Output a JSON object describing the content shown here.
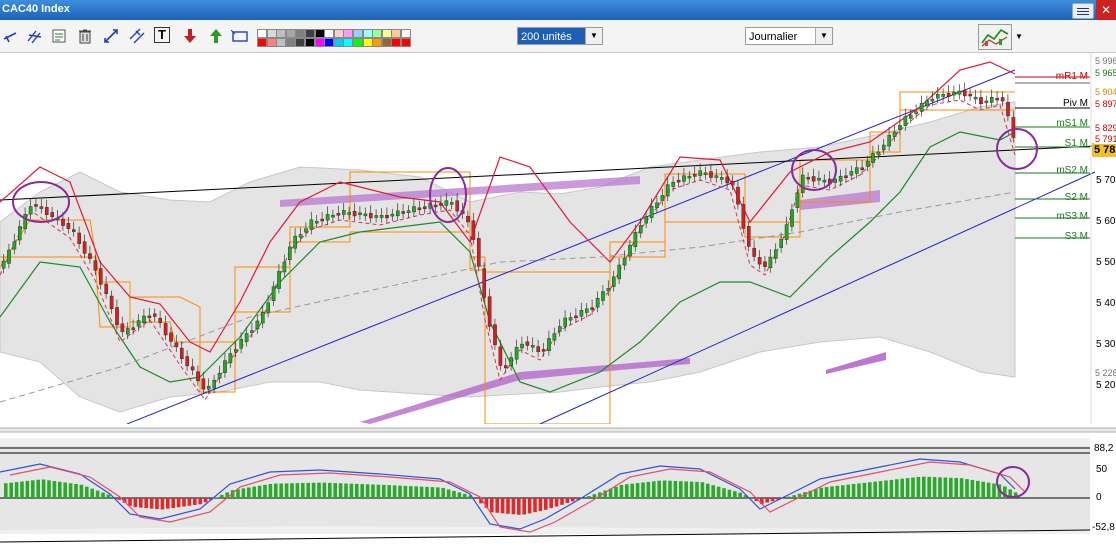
{
  "window": {
    "title": "CAC40 Index",
    "close_symbol": "✕"
  },
  "toolbar": {
    "tools": [
      "cursor-icon",
      "multi-line-icon",
      "draw-line-icon",
      "report-icon",
      "trash-icon",
      "scale-arrows-icon",
      "parallel-lines-icon",
      "text-tool-icon",
      "buy-arrow-icon",
      "sell-arrow-icon",
      "rectangle-tool-icon"
    ],
    "text_tool_glyph": "T",
    "units_select": "200 unités",
    "period_select": "Journalier",
    "palette": [
      "#ffffff",
      "#d9d9d9",
      "#bfbfbf",
      "#a6a6a6",
      "#808080",
      "#404040",
      "#000000",
      "#ffffff",
      "#ffcccc",
      "#ff99ff",
      "#99ccff",
      "#99ffff",
      "#99ff99",
      "#ffff99",
      "#ffcc99",
      "#ffffff",
      "#ff0000",
      "#ff8080",
      "#c0c0c0",
      "#808080",
      "#404040",
      "#000000",
      "#ff00ff",
      "#0000ff",
      "#00ccff",
      "#00ffff",
      "#00ff00",
      "#ffff00",
      "#ff9900",
      "#996633",
      "#ff0000",
      "#ff0000"
    ]
  },
  "main_chart": {
    "y_axis_labels": [
      "5 70",
      "5 60",
      "5 50",
      "5 40",
      "5 30",
      "5 20"
    ],
    "current_price": "5 78",
    "pivot_labels": [
      "mR1 M",
      "Piv M",
      "mS1 M",
      "S1 M",
      "mS2 M",
      "S2 M",
      "mS3 M",
      "S3 M"
    ],
    "price_tags": [
      {
        "text": "5 996",
        "color": "#707070"
      },
      {
        "text": "5 965",
        "color": "#1a7a1a"
      },
      {
        "text": "5 904",
        "color": "#e08000"
      },
      {
        "text": "5 897",
        "color": "#cc0000"
      },
      {
        "text": "5 829",
        "color": "#cc0000"
      },
      {
        "text": "5 791",
        "color": "#cc0000"
      },
      {
        "text": "5 228",
        "color": "#707070"
      }
    ]
  },
  "oscillator": {
    "y_axis_labels": [
      "88,2",
      "50",
      "0",
      "-52,8"
    ]
  },
  "colors": {
    "up_candle": "#22a822",
    "down_candle": "#d42020",
    "bollinger": "#e0e0e0",
    "channel": "#1f1fd0",
    "pivot": "#ff8a00",
    "highlight_circle": "#8a2a9a"
  }
}
